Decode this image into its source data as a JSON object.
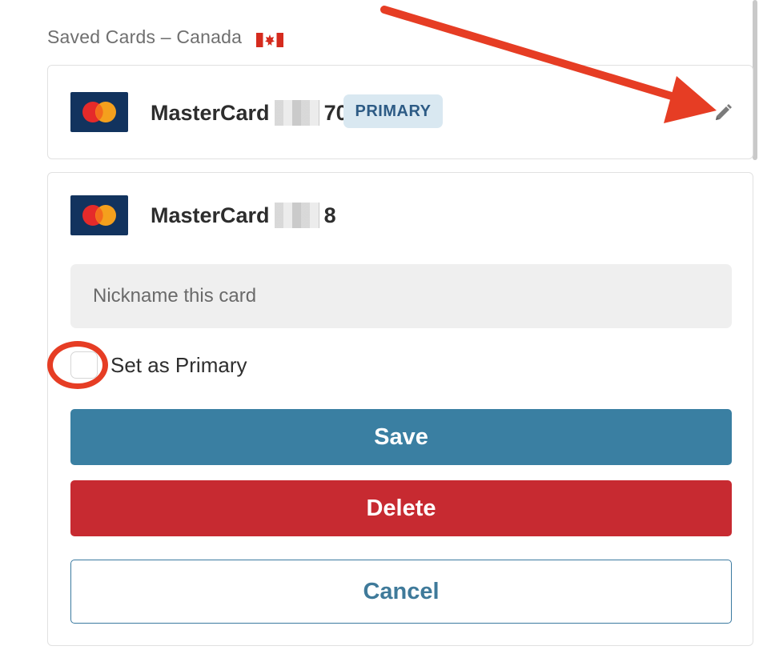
{
  "section": {
    "title": "Saved Cards – Canada",
    "flag_icon": "canada-flag-icon"
  },
  "saved_cards": [
    {
      "brand": "MasterCard",
      "suffix": "70",
      "badge": "PRIMARY",
      "logo_icon": "mastercard-icon"
    },
    {
      "brand": "MasterCard",
      "suffix": "8",
      "logo_icon": "mastercard-icon"
    }
  ],
  "edit_icon": "pencil-icon",
  "form": {
    "nickname_placeholder": "Nickname this card",
    "set_primary_label": "Set as Primary",
    "save_label": "Save",
    "delete_label": "Delete",
    "cancel_label": "Cancel"
  },
  "colors": {
    "save": "#3a7fa2",
    "delete": "#c72a31",
    "cancel_text": "#3f7a9a",
    "badge_bg": "#d9e8f1",
    "annotation": "#e63d24"
  }
}
